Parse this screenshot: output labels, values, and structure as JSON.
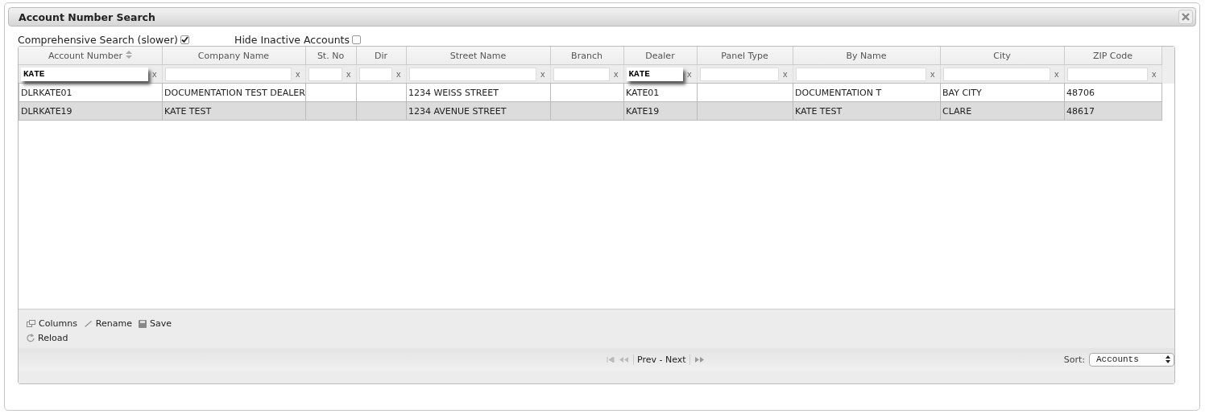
{
  "window": {
    "title": "Account Number Search"
  },
  "options": [
    {
      "label": "Comprehensive Search (slower)",
      "checked": true
    },
    {
      "label": "Hide Inactive Accounts",
      "checked": false
    }
  ],
  "table": {
    "columns": [
      {
        "label": "Account Number",
        "sortable": true
      },
      {
        "label": "Company Name",
        "sortable": false
      },
      {
        "label": "St. No",
        "sortable": false
      },
      {
        "label": "Dir",
        "sortable": false
      },
      {
        "label": "Street Name",
        "sortable": false
      },
      {
        "label": "Branch",
        "sortable": false
      },
      {
        "label": "Dealer",
        "sortable": false
      },
      {
        "label": "Panel Type",
        "sortable": false
      },
      {
        "label": "By Name",
        "sortable": false
      },
      {
        "label": "City",
        "sortable": false
      },
      {
        "label": "ZIP Code",
        "sortable": false
      }
    ],
    "filters": [
      {
        "value": "KATE",
        "active": true,
        "clear": "x"
      },
      {
        "active": false,
        "clear": "x"
      },
      {
        "active": false,
        "clear": "x"
      },
      {
        "active": false,
        "clear": "x"
      },
      {
        "active": false,
        "clear": "x"
      },
      {
        "active": false,
        "clear": "x"
      },
      {
        "value": "KATE",
        "active": true,
        "clear": "x"
      },
      {
        "active": false,
        "clear": "x"
      },
      {
        "active": false,
        "clear": "x"
      },
      {
        "active": false,
        "clear": "x"
      },
      {
        "active": false,
        "clear": "x"
      }
    ],
    "rows": [
      {
        "selected": false,
        "cells": [
          "DLRKATE01",
          "DOCUMENTATION TEST DEALER",
          "",
          "",
          "1234 WEISS STREET",
          "",
          "KATE01",
          "",
          "DOCUMENTATION T",
          "BAY CITY",
          "48706"
        ]
      },
      {
        "selected": true,
        "cells": [
          "DLRKATE19",
          "KATE TEST",
          "",
          "",
          "1234 AVENUE STREET",
          "",
          "KATE19",
          "",
          "KATE TEST",
          "CLARE",
          "48617"
        ]
      }
    ]
  },
  "toolbar": [
    {
      "kind": "columns",
      "label": "Columns"
    },
    {
      "kind": "rename",
      "label": "Rename"
    },
    {
      "kind": "save",
      "label": "Save"
    },
    {
      "kind": "reload",
      "label": "Reload"
    }
  ],
  "pager": {
    "label": "Prev - Next"
  },
  "sort": {
    "label": "Sort:",
    "value": "Accounts"
  }
}
